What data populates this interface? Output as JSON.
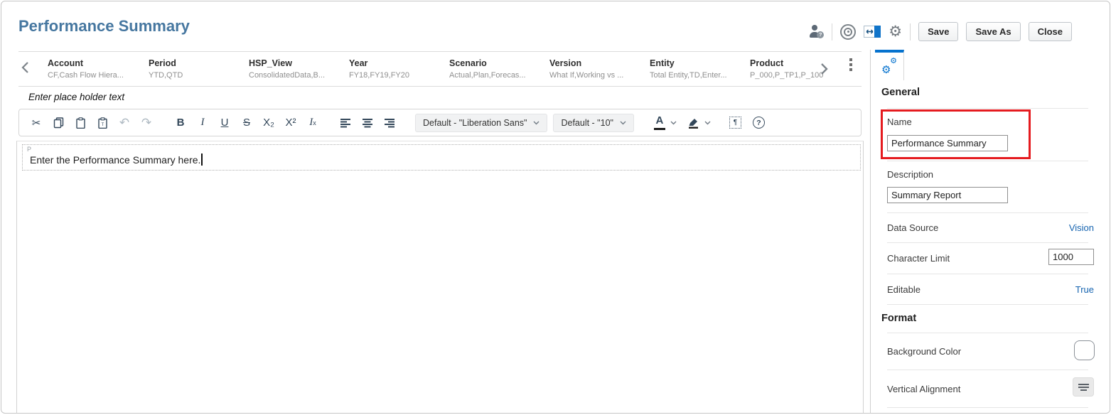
{
  "colors": {
    "accent": "#0572ce",
    "title_blue": "#4677a0",
    "link_blue": "#1664b0",
    "annotation_red": "#e51b1f"
  },
  "page": {
    "title": "Performance Summary"
  },
  "actions": {
    "save": "Save",
    "save_as": "Save As",
    "close": "Close"
  },
  "icons": {
    "cut": "✂",
    "undo": "↶",
    "redo": "↷",
    "gear": "⚙",
    "help": "?",
    "select_all": "¶",
    "names": [
      "user-assistance-icon",
      "target-icon",
      "panel-layout-icon",
      "settings-gear-icon",
      "copy-icon",
      "paste-icon",
      "paste-text-icon",
      "text-color-icon",
      "highlight-color-icon",
      "prev-dimensions-chevron",
      "next-dimensions-chevron",
      "overflow-menu-icon",
      "gears-tab-icon",
      "vertical-alignment-icon"
    ]
  },
  "dimension_bar": {
    "items": [
      {
        "name": "Account",
        "members": "CF,Cash Flow Hiera..."
      },
      {
        "name": "Period",
        "members": "YTD,QTD"
      },
      {
        "name": "HSP_View",
        "members": "ConsolidatedData,B..."
      },
      {
        "name": "Year",
        "members": "FY18,FY19,FY20"
      },
      {
        "name": "Scenario",
        "members": "Actual,Plan,Forecas..."
      },
      {
        "name": "Version",
        "members": "What If,Working vs ..."
      },
      {
        "name": "Entity",
        "members": "Total Entity,TD,Enter..."
      },
      {
        "name": "Product",
        "members": "P_000,P_TP1,P_100"
      }
    ]
  },
  "placeholder_hint": "Enter place holder text",
  "toolbar": {
    "bold": "B",
    "italic": "I",
    "underline": "U",
    "strikethrough": "S",
    "subscript": "X₂",
    "superscript": "X²",
    "clear_format_i": "I",
    "clear_format_x": "x",
    "font_family_dropdown": "Default - \"Liberation Sans\"",
    "font_size_dropdown": "Default - \"10\"",
    "text_color": "A"
  },
  "editor": {
    "paragraph_tag": "P",
    "content": "Enter the Performance Summary here."
  },
  "panel": {
    "general": {
      "title": "General",
      "name_label": "Name",
      "name_value": "Performance Summary",
      "description_label": "Description",
      "description_value": "Summary Report",
      "data_source_label": "Data Source",
      "data_source_value": "Vision",
      "character_limit_label": "Character Limit",
      "character_limit_value": "1000",
      "editable_label": "Editable",
      "editable_value": "True"
    },
    "format": {
      "title": "Format",
      "background_color_label": "Background Color",
      "vertical_alignment_label": "Vertical Alignment"
    }
  }
}
